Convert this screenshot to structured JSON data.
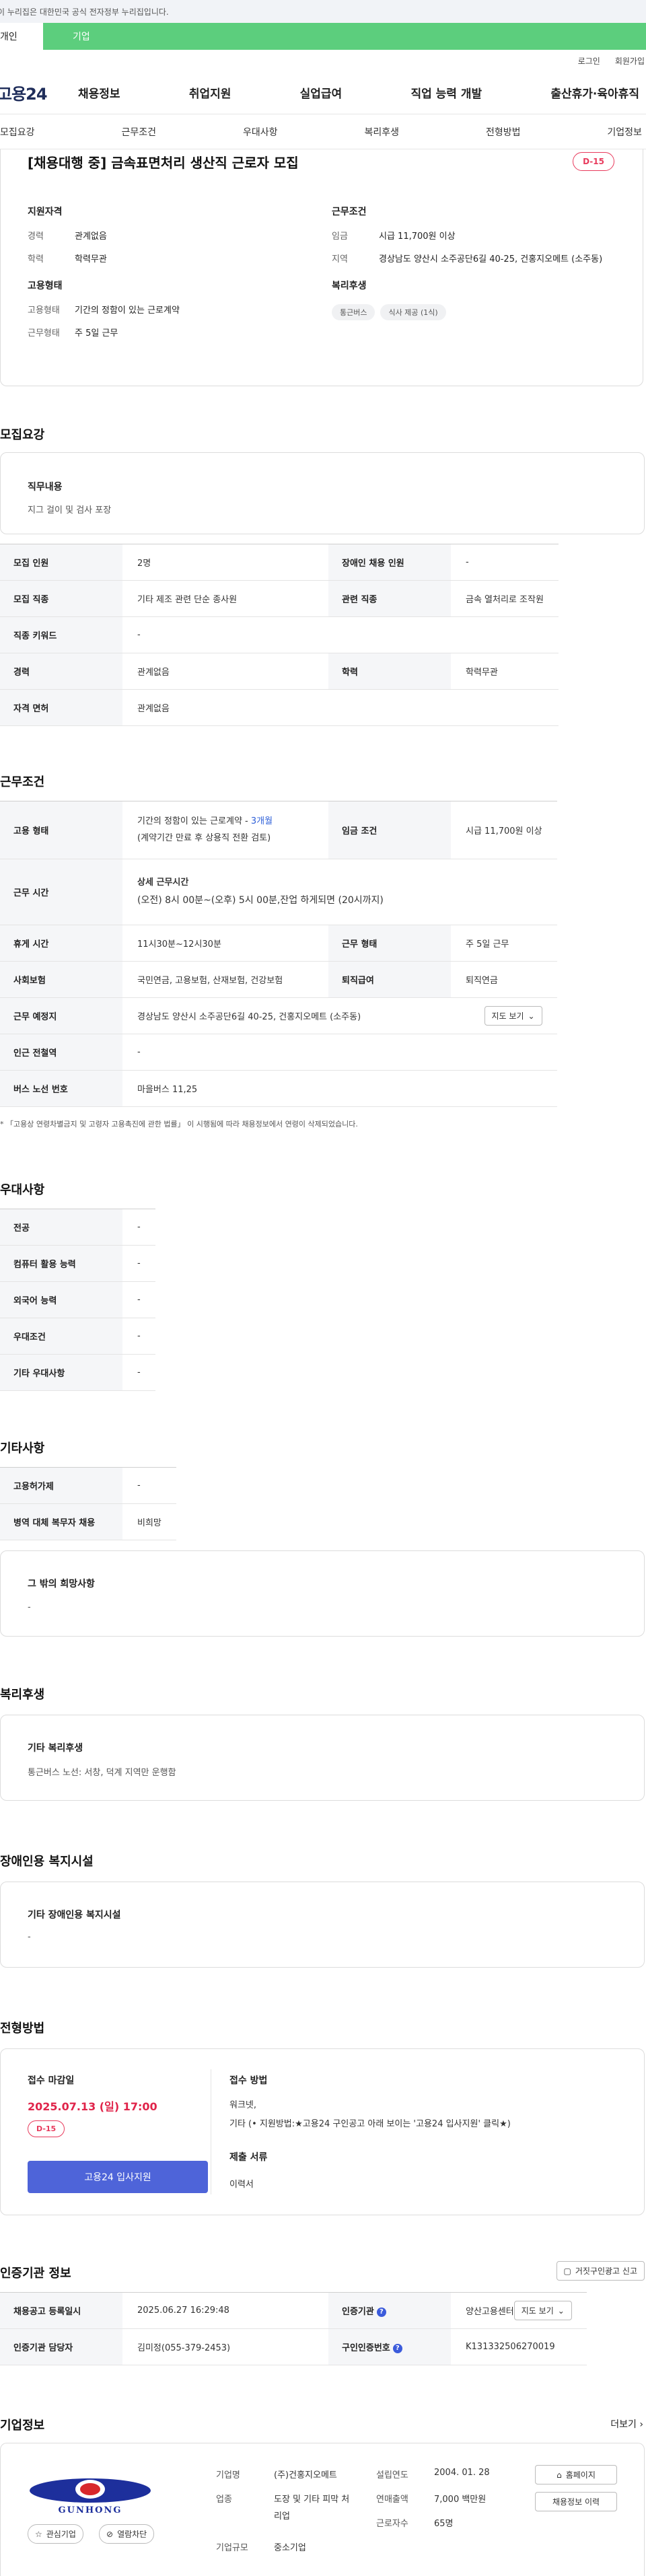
{
  "gov_banner": "이 누리집은 대한민국 공식 전자정부 누리집입니다.",
  "user_tabs": {
    "personal": "개인",
    "company": "기업"
  },
  "top_links": {
    "login": "로그인",
    "signup": "회원가입"
  },
  "logo": "고용24",
  "gnb": [
    "채용정보",
    "취업지원",
    "실업급여",
    "직업 능력 개발",
    "출산휴가·육아휴직"
  ],
  "anchor_tabs": [
    "모집요강",
    "근무조건",
    "우대사항",
    "복리후생",
    "전형방법",
    "기업정보"
  ],
  "summary": {
    "title": "[채용대행 중] 금속표면처리 생산직 근로자 모집",
    "dday": "D-15",
    "qual_title": "지원자격",
    "qual": [
      {
        "k": "경력",
        "v": "관계없음"
      },
      {
        "k": "학력",
        "v": "학력무관"
      }
    ],
    "cond_title": "근무조건",
    "cond": [
      {
        "k": "임금",
        "v": "시급 11,700원 이상"
      },
      {
        "k": "지역",
        "v": "경상남도 양산시 소주공단6길 40-25, 건홍지오메트 (소주동)"
      }
    ],
    "emp_title": "고용형태",
    "emp": [
      {
        "k": "고용형태",
        "v": "기간의 정함이 있는 근로계약"
      },
      {
        "k": "근무형태",
        "v": "주 5일 근무"
      }
    ],
    "welfare_title": "복리후생",
    "welfare_chips": [
      "통근버스",
      "식사 제공 (1식)"
    ]
  },
  "recruit": {
    "section": "모집요강",
    "job_title": "직무내용",
    "job_desc": "지그 걸이 및 검사 포장",
    "rows": [
      {
        "k1": "모집 인원",
        "v1": "2명",
        "k2": "장애인 채용 인원",
        "v2": "-"
      },
      {
        "k1": "모집 직종",
        "v1": "기타 제조 관련 단순 종사원",
        "k2": "관련 직종",
        "v2": "금속 열처리로 조작원"
      },
      {
        "k1": "직종 키워드",
        "v1": "-"
      },
      {
        "k1": "경력",
        "v1": "관계없음",
        "k2": "학력",
        "v2": "학력무관"
      },
      {
        "k1": "자격 면허",
        "v1": "관계없음"
      }
    ]
  },
  "work": {
    "section": "근무조건",
    "emp_k": "고용 형태",
    "emp_v1": "기간의 정함이 있는 근로계약 - ",
    "emp_period": "3개월",
    "emp_v2": "(계약기간 만료 후 상용직 전환 검토)",
    "wage_k": "임금 조건",
    "wage_v": "시급 11,700원 이상",
    "time_k": "근무 시간",
    "time_title": "상세 근무시간",
    "time_v": "(오전) 8시 00분~(오후) 5시 00분,잔업 하게되면 (20시까지)",
    "rest_k": "휴게 시간",
    "rest_v": "11시30분~12시30분",
    "form_k": "근무 형태",
    "form_v": "주 5일 근무",
    "ins_k": "사회보험",
    "ins_v": "국민연금, 고용보험, 산재보험, 건강보험",
    "ret_k": "퇴직급여",
    "ret_v": "퇴직연금",
    "place_k": "근무 예정지",
    "place_v": "경상남도 양산시 소주공단6길 40-25, 건홍지오메트 (소주동)",
    "map_btn": "지도 보기",
    "subway_k": "인근 전철역",
    "subway_v": "-",
    "bus_k": "버스 노선 번호",
    "bus_v": "마을버스 11,25",
    "note": "* 「고용상 연령차별금지 및 고령자 고용촉진에 관한 법률」 이 시행됨에 따라 채용정보에서 연령이 삭제되었습니다."
  },
  "pref": {
    "section": "우대사항",
    "rows": [
      {
        "k": "전공",
        "v": "-"
      },
      {
        "k": "컴퓨터 활용 능력",
        "v": "-"
      },
      {
        "k": "외국어 능력",
        "v": "-"
      },
      {
        "k": "우대조건",
        "v": "-"
      },
      {
        "k": "기타 우대사항",
        "v": "-"
      }
    ]
  },
  "etc": {
    "section": "기타사항",
    "rows": [
      {
        "k": "고용허가제",
        "v": "-"
      },
      {
        "k": "병역 대체 복무자 채용",
        "v": "비희망"
      }
    ],
    "hope_title": "그 밖의 희망사항",
    "hope_v": "-"
  },
  "welfare": {
    "section": "복리후생",
    "title": "기타 복리후생",
    "value": "통근버스 노선: 서창, 덕계 지역만 운행함"
  },
  "disabled": {
    "section": "장애인용 복지시설",
    "title": "기타 장애인용 복지시설",
    "value": "-"
  },
  "apply": {
    "section": "전형방법",
    "deadline_title": "접수 마감일",
    "deadline": "2025.07.13 (일) 17:00",
    "dday": "D-15",
    "button": "고용24 입사지원",
    "method_title": "접수 방법",
    "method_v1": "워크넷,",
    "method_v2": "기타 (• 지원방법:★고용24 구인공고 아래 보이는 '고용24 입사지원' 클릭★)",
    "docs_title": "제출 서류",
    "docs_v": "이력서"
  },
  "cert": {
    "section": "인증기관 정보",
    "report_btn": "거짓구인광고 신고",
    "reg_k": "채용공고 등록일시",
    "reg_v": "2025.06.27 16:29:48",
    "org_k": "인증기관",
    "org_v": "양산고용센터",
    "map_btn": "지도 보기",
    "mgr_k": "인증기관 담당자",
    "mgr_v": "김미정(055-379-2453)",
    "no_k": "구인인증번호",
    "no_v": "K131332506270019"
  },
  "company": {
    "section": "기업정보",
    "more": "더보기",
    "logo_text": "GUNHONG",
    "fav_btn": "관심기업",
    "block_btn": "열람차단",
    "name_k": "기업명",
    "name_v": "(주)건홍지오메트",
    "ind_k": "업종",
    "ind_v": "도장 및 기타 피막 처리업",
    "size_k": "기업규모",
    "size_v": "중소기업",
    "year_k": "설립연도",
    "year_v": "2004. 01. 28",
    "sales_k": "연매출액",
    "sales_v": "7,000 백만원",
    "emp_k": "근로자수",
    "emp_v": "65명",
    "home_btn": "홈페이지",
    "jobs_btn": "채용정보 이력"
  }
}
